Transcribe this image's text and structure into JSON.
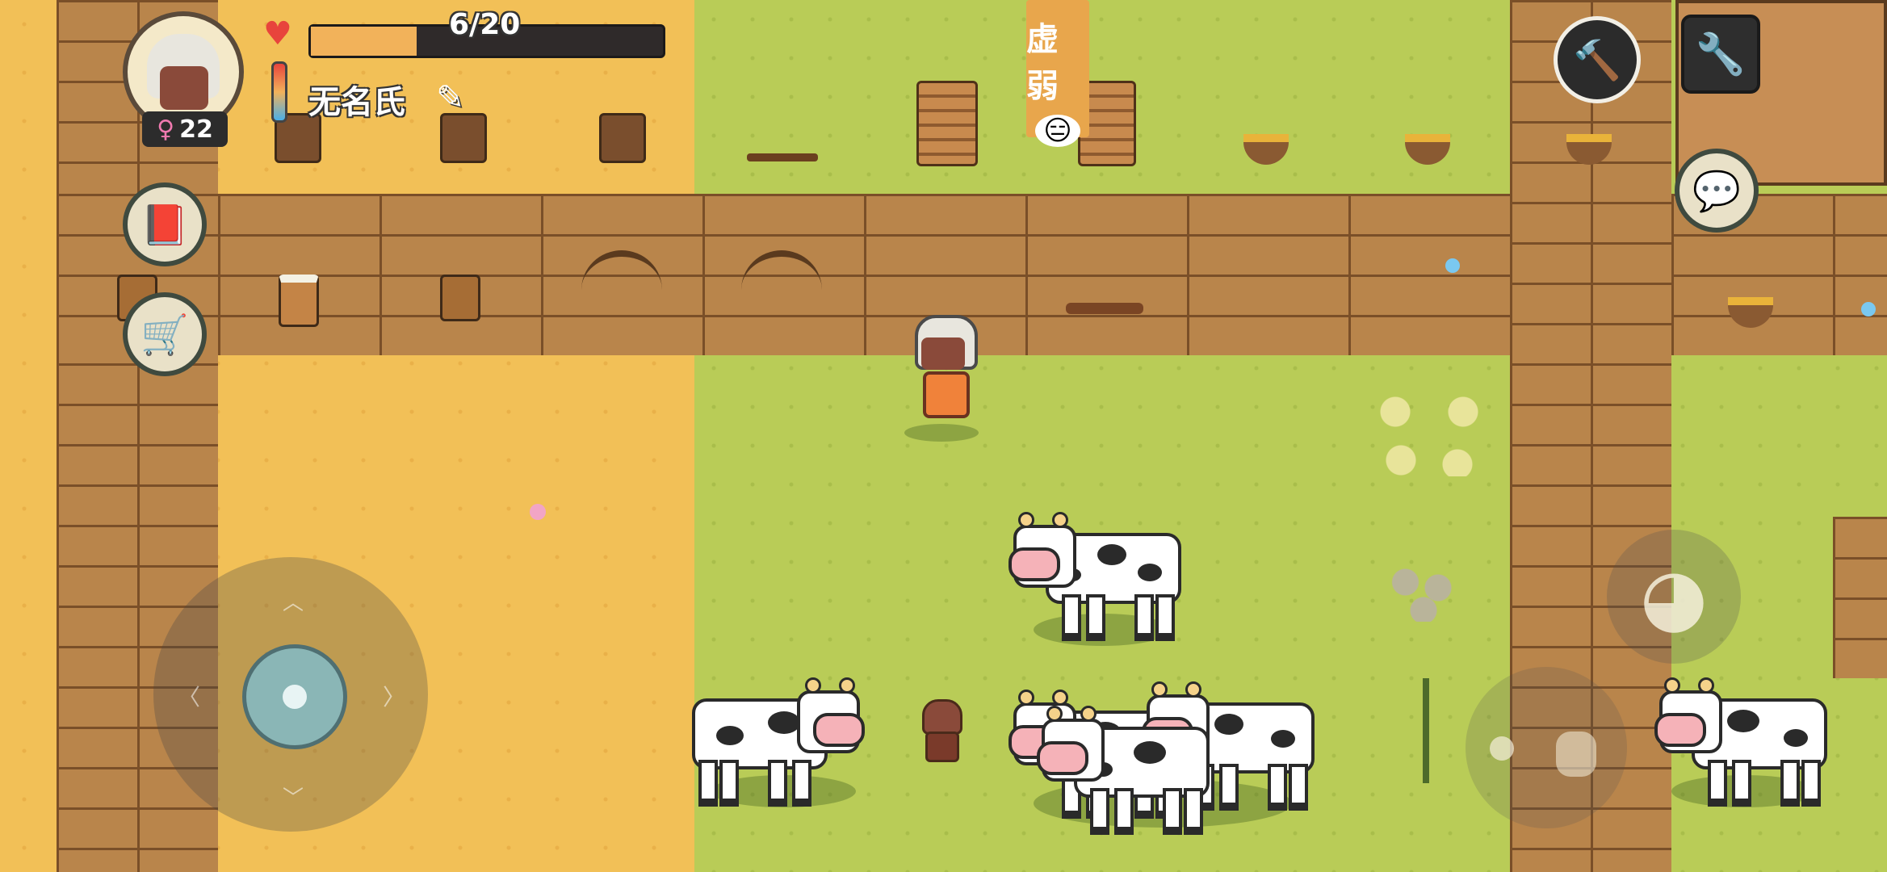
{
  "hud": {
    "hp_text": "6/20",
    "hp_fraction": 0.3,
    "player_name": "无名氏",
    "age": "22",
    "gender_symbol": "♀",
    "status_label": "虚弱",
    "status_face": "😑"
  },
  "icons": {
    "heart": "♥",
    "edit": "✎",
    "chat": "💬",
    "wrench": "🔧",
    "hammer": "🔨",
    "cart": "🛒",
    "book": "📕",
    "eat": "◕",
    "joy_arrows": "◁ ▷"
  },
  "colors": {
    "sand": "#f2c057",
    "grass": "#b9cc57",
    "wood": "#b9854b",
    "status_tag": "#e8a64c",
    "hp_fill": "#f2b25a"
  }
}
